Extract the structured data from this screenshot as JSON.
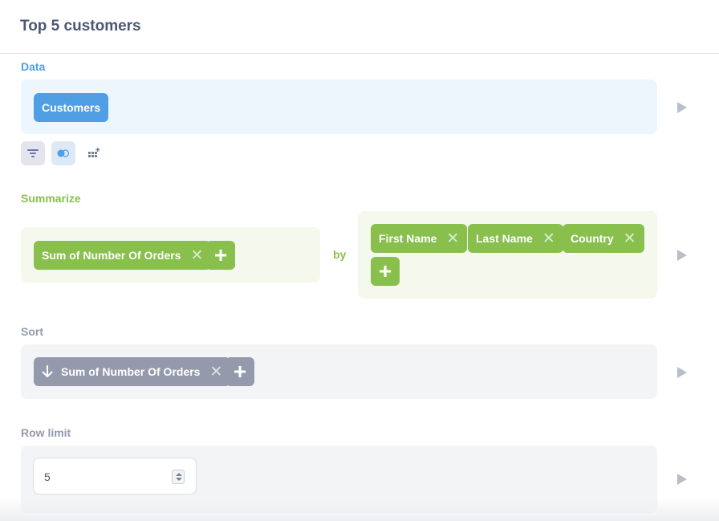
{
  "header": {
    "title": "Top 5 customers"
  },
  "data_section": {
    "label": "Data",
    "table": "Customers"
  },
  "tools": [
    "filter-icon",
    "join-icon",
    "custom-column-icon"
  ],
  "summarize_section": {
    "label": "Summarize",
    "metrics": [
      "Sum of Number Of Orders"
    ],
    "by_label": "by",
    "breakouts": [
      "First Name",
      "Last Name",
      "Country"
    ]
  },
  "sort_section": {
    "label": "Sort",
    "items": [
      {
        "direction_icon": "arrow-down-icon",
        "label": "Sum of Number Of Orders"
      }
    ]
  },
  "limit_section": {
    "label": "Row limit",
    "value": "5"
  },
  "colors": {
    "data_accent": "#509ee3",
    "summarize_accent": "#88bf4d",
    "sort_accent": "#949aab"
  }
}
